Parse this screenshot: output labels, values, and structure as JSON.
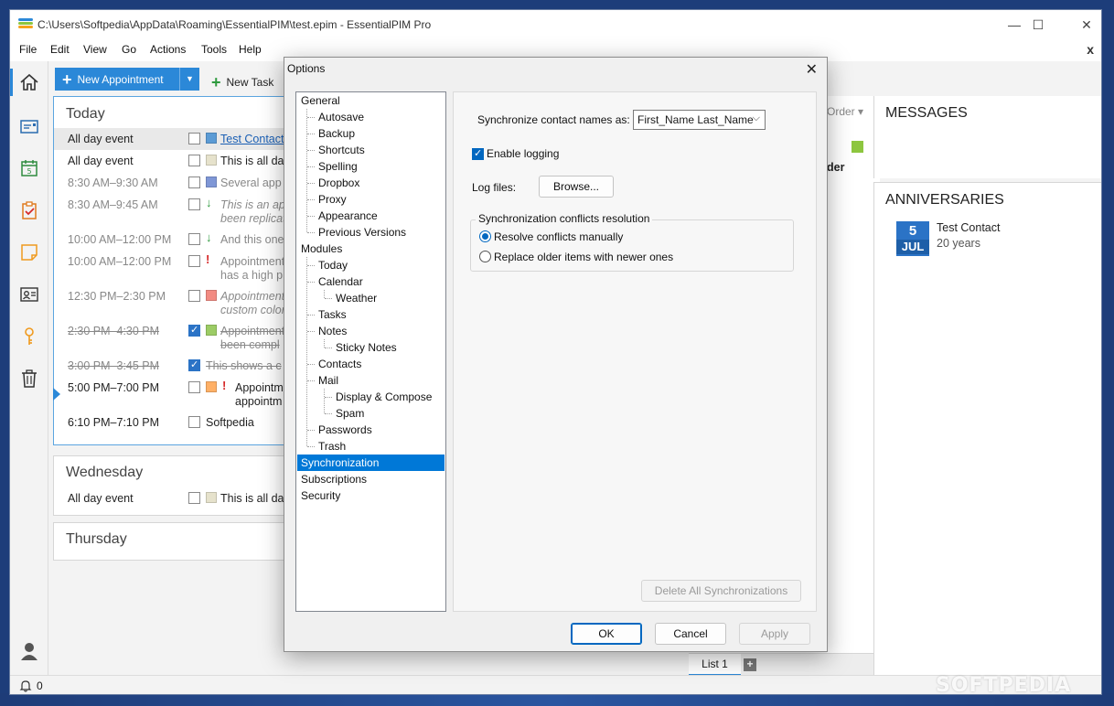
{
  "window": {
    "title": "C:\\Users\\Softpedia\\AppData\\Roaming\\EssentialPIM\\test.epim - EssentialPIM Pro",
    "minimize": "—",
    "maximize": "☐",
    "close": "✕"
  },
  "menu": [
    "File",
    "Edit",
    "View",
    "Go",
    "Actions",
    "Tools",
    "Help"
  ],
  "menu_close": "x",
  "toolbar": {
    "new_appointment": "New Appointment",
    "new_task": "New Task"
  },
  "days": {
    "today": {
      "title": "Today",
      "events": [
        {
          "time": "All day event",
          "text": "Test Contact"
        },
        {
          "time": "All day event",
          "text": "This is all day"
        },
        {
          "time": "8:30 AM–9:30 AM",
          "text": "Several app"
        },
        {
          "time": "8:30 AM–9:45 AM",
          "text": "This is an app",
          "sub": "been replicat"
        },
        {
          "time": "10:00 AM–12:00 PM",
          "text": "And this one"
        },
        {
          "time": "10:00 AM–12:00 PM",
          "text": "Appointment",
          "sub": "has a high p"
        },
        {
          "time": "12:30 PM–2:30 PM",
          "text": "Appointment",
          "sub": "custom color"
        },
        {
          "time": "2:30 PM–4:30 PM",
          "text": "Appointment",
          "sub": "been compl"
        },
        {
          "time": "3:00 PM–3:45 PM",
          "text": "This shows a c"
        },
        {
          "time": "5:00 PM–7:00 PM",
          "text": "Appointm",
          "sub": "appointm"
        },
        {
          "time": "6:10 PM–7:10 PM",
          "text": "Softpedia"
        }
      ]
    },
    "wednesday": {
      "title": "Wednesday",
      "events": [
        {
          "time": "All day event",
          "text": "This is all da"
        }
      ]
    },
    "thursday": {
      "title": "Thursday"
    }
  },
  "mid_column": {
    "order": "Order ▾",
    "fragment": "der"
  },
  "messages": {
    "title": "MESSAGES"
  },
  "anniversaries": {
    "title": "ANNIVERSARIES",
    "items": [
      {
        "day": "5",
        "month": "JUL",
        "name": "Test Contact",
        "years": "20 years"
      }
    ]
  },
  "list_tabs": {
    "active": "List 1",
    "add": "+"
  },
  "status": {
    "notifications": "0",
    "watermark": "SOFTPEDIA"
  },
  "options_dialog": {
    "title": "Options",
    "close": "✕",
    "tree": {
      "general": "General",
      "general_children": [
        "Autosave",
        "Backup",
        "Shortcuts",
        "Spelling",
        "Dropbox",
        "Proxy",
        "Appearance",
        "Previous Versions"
      ],
      "modules": "Modules",
      "modules_children": {
        "today": "Today",
        "calendar": "Calendar",
        "weather": "Weather",
        "tasks": "Tasks",
        "notes": "Notes",
        "sticky_notes": "Sticky Notes",
        "contacts": "Contacts",
        "mail": "Mail",
        "display_compose": "Display & Compose",
        "spam": "Spam",
        "passwords": "Passwords",
        "trash": "Trash"
      },
      "synchronization": "Synchronization",
      "subscriptions": "Subscriptions",
      "security": "Security"
    },
    "sync": {
      "contact_names_label": "Synchronize contact names as:",
      "contact_names_value": "First_Name Last_Name",
      "enable_logging": "Enable logging",
      "enable_logging_checked": true,
      "log_files_label": "Log files:",
      "browse": "Browse...",
      "conflicts_group": "Synchronization conflicts resolution",
      "resolve_manually": "Resolve conflicts manually",
      "replace_older": "Replace older items with newer ones",
      "selected_conflict_option": "resolve_manually",
      "delete_all": "Delete All Synchronizations"
    },
    "buttons": {
      "ok": "OK",
      "cancel": "Cancel",
      "apply": "Apply"
    }
  },
  "colors": {
    "accent": "#2b88d8",
    "selection": "#0078d7",
    "swatch_blue": "#5b9bd5",
    "swatch_beige": "#e6e2cc",
    "swatch_periwinkle": "#7f97d6",
    "swatch_salmon": "#f28b82",
    "swatch_green": "#9ccc65",
    "swatch_orange": "#ffb066",
    "priority_red": "#d62828",
    "low_priority_green": "#2e9a3e"
  }
}
